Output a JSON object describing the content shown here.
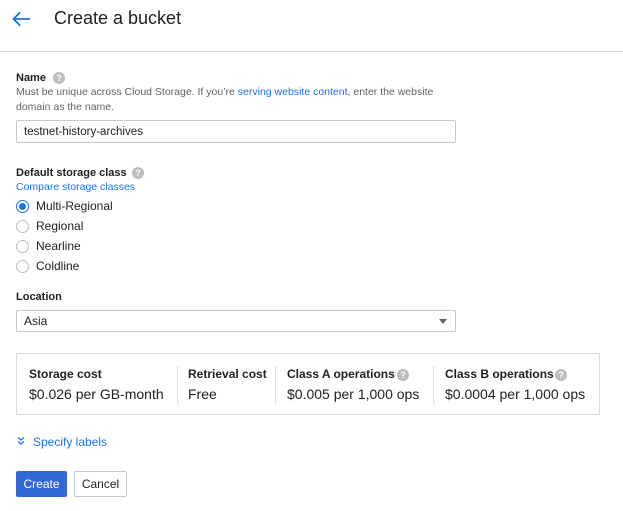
{
  "header": {
    "title": "Create a bucket"
  },
  "name_section": {
    "label": "Name",
    "help": "?",
    "desc_part1": "Must be unique across Cloud Storage. If you’re ",
    "desc_link": "serving website content",
    "desc_part2": ", enter the website domain as the name.",
    "value": "testnet-history-archives"
  },
  "storage_class": {
    "label": "Default storage class",
    "help": "?",
    "compare_link": "Compare storage classes",
    "options": [
      "Multi-Regional",
      "Regional",
      "Nearline",
      "Coldline"
    ],
    "selected": "Multi-Regional"
  },
  "location": {
    "label": "Location",
    "value": "Asia"
  },
  "costs": [
    {
      "heading": "Storage cost",
      "value": "$0.026 per GB-month"
    },
    {
      "heading": "Retrieval cost",
      "value": "Free"
    },
    {
      "heading": "Class A operations",
      "value": "$0.005 per 1,000 ops",
      "help": "?"
    },
    {
      "heading": "Class B operations",
      "value": "$0.0004 per 1,000 ops",
      "help": "?"
    }
  ],
  "labels_toggle": {
    "label": "Specify labels"
  },
  "actions": {
    "create": "Create",
    "cancel": "Cancel"
  },
  "colors": {
    "accent": "#1a73e8",
    "primary_button": "#3367d6"
  }
}
